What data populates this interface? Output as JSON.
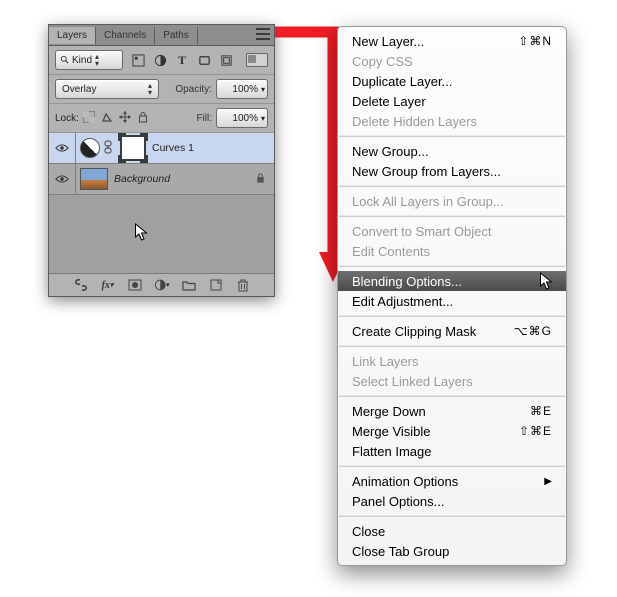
{
  "panel": {
    "tabs": [
      "Layers",
      "Channels",
      "Paths"
    ],
    "active_tab": 0,
    "filter_label": "Kind",
    "blend_mode": "Overlay",
    "opacity_label": "Opacity:",
    "opacity_value": "100%",
    "lock_label": "Lock:",
    "fill_label": "Fill:",
    "fill_value": "100%",
    "layers": [
      {
        "name": "Curves 1",
        "type": "adjustment",
        "visible": true,
        "selected": true,
        "locked": false,
        "italic": false
      },
      {
        "name": "Background",
        "type": "image",
        "visible": true,
        "selected": false,
        "locked": true,
        "italic": true
      }
    ]
  },
  "menu": {
    "groups": [
      [
        {
          "label": "New Layer...",
          "enabled": true,
          "shortcut": "⇧⌘N"
        },
        {
          "label": "Copy CSS",
          "enabled": false
        },
        {
          "label": "Duplicate Layer...",
          "enabled": true
        },
        {
          "label": "Delete Layer",
          "enabled": true
        },
        {
          "label": "Delete Hidden Layers",
          "enabled": false
        }
      ],
      [
        {
          "label": "New Group...",
          "enabled": true
        },
        {
          "label": "New Group from Layers...",
          "enabled": true
        }
      ],
      [
        {
          "label": "Lock All Layers in Group...",
          "enabled": false
        }
      ],
      [
        {
          "label": "Convert to Smart Object",
          "enabled": false
        },
        {
          "label": "Edit Contents",
          "enabled": false
        }
      ],
      [
        {
          "label": "Blending Options...",
          "enabled": true,
          "highlight": true
        },
        {
          "label": "Edit Adjustment...",
          "enabled": true
        }
      ],
      [
        {
          "label": "Create Clipping Mask",
          "enabled": true,
          "shortcut": "⌥⌘G"
        }
      ],
      [
        {
          "label": "Link Layers",
          "enabled": false
        },
        {
          "label": "Select Linked Layers",
          "enabled": false
        }
      ],
      [
        {
          "label": "Merge Down",
          "enabled": true,
          "shortcut": "⌘E"
        },
        {
          "label": "Merge Visible",
          "enabled": true,
          "shortcut": "⇧⌘E"
        },
        {
          "label": "Flatten Image",
          "enabled": true
        }
      ],
      [
        {
          "label": "Animation Options",
          "enabled": true,
          "submenu": true
        },
        {
          "label": "Panel Options...",
          "enabled": true
        }
      ],
      [
        {
          "label": "Close",
          "enabled": true
        },
        {
          "label": "Close Tab Group",
          "enabled": true
        }
      ]
    ]
  },
  "colors": {
    "panel_bg": "#b3b3b3",
    "selection": "#c9d6ef",
    "menu_highlight": "#5a5a5a",
    "arrow": "#ee1c25"
  }
}
